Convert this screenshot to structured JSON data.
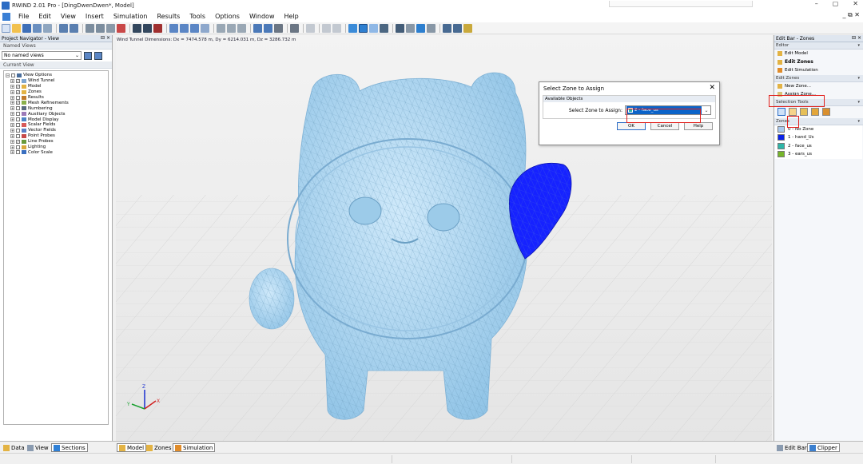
{
  "window": {
    "title": "RWIND 2.01 Pro - [DingDwenDwen*, Model]",
    "controls": [
      "–",
      "▢",
      "✕"
    ]
  },
  "menu": {
    "items": [
      "File",
      "Edit",
      "View",
      "Insert",
      "Simulation",
      "Results",
      "Tools",
      "Options",
      "Window",
      "Help"
    ],
    "mdi_controls": "_ ⧉ ✕"
  },
  "navigator": {
    "header": "Project Navigator - View",
    "pin": "⊟ ×",
    "named_views_label": "Named Views",
    "named_views_value": "No named views",
    "current_view_label": "Current View",
    "tree": [
      {
        "label": "View Options",
        "level": 0,
        "checked": false
      },
      {
        "label": "Wind Tunnel",
        "level": 1,
        "checked": true
      },
      {
        "label": "Model",
        "level": 1,
        "checked": true
      },
      {
        "label": "Zones",
        "level": 1,
        "checked": true
      },
      {
        "label": "Results",
        "level": 1,
        "checked": false
      },
      {
        "label": "Mesh Refinements",
        "level": 1,
        "checked": true
      },
      {
        "label": "Numbering",
        "level": 1,
        "checked": false
      },
      {
        "label": "Auxiliary Objects",
        "level": 1,
        "checked": false
      },
      {
        "label": "Model Display",
        "level": 1,
        "checked": false
      },
      {
        "label": "Scalar Fields",
        "level": 1,
        "checked": false
      },
      {
        "label": "Vector Fields",
        "level": 1,
        "checked": false
      },
      {
        "label": "Point Probes",
        "level": 1,
        "checked": false
      },
      {
        "label": "Line Probes",
        "level": 1,
        "checked": true
      },
      {
        "label": "Lighting",
        "level": 1,
        "checked": false
      },
      {
        "label": "Color Scale",
        "level": 1,
        "checked": false
      }
    ]
  },
  "viewport": {
    "dimensions": "Wind Tunnel Dimensions: Dx = 7474.578 m, Dy = 6214.031 m, Dz = 3286.732 m",
    "axes": {
      "x": "X",
      "y": "Y",
      "z": "Z"
    }
  },
  "dialog": {
    "title": "Select Zone to Assign",
    "close": "✕",
    "group_label": "Available Objects",
    "field_label": "Select Zone to Assign:",
    "selected_zone": "2 - face_us",
    "buttons": {
      "ok": "OK",
      "cancel": "Cancel",
      "help": "Help"
    }
  },
  "editbar": {
    "header": "Edit Bar - Zones",
    "pin": "⊟ ×",
    "editor_label": "Editor",
    "editor_items": [
      "Edit Model",
      "Edit Zones",
      "Edit Simulation"
    ],
    "edit_zones_label": "Edit Zones",
    "edit_zone_items": [
      "New Zone...",
      "Assign Zone..."
    ],
    "selection_tools_label": "Selection Tools",
    "zones_label": "Zones",
    "zones": [
      {
        "label": "0 - No Zone",
        "color": "#a9c9ee"
      },
      {
        "label": "1 - hand_Us",
        "color": "#0a22e8"
      },
      {
        "label": "2 - face_us",
        "color": "#2fb6a8"
      },
      {
        "label": "3 - ears_us",
        "color": "#76b52a"
      }
    ]
  },
  "bottom_tabs": {
    "left": [
      "Data",
      "View",
      "Sections"
    ],
    "center": [
      "Model",
      "Zones",
      "Simulation"
    ],
    "right": [
      "Edit Bar",
      "Clipper"
    ]
  },
  "colors": {
    "model_fill": "#a9d4f0",
    "hand_zone": "#1622ff",
    "highlight": "#e2201c",
    "selection": "#0b63c8"
  }
}
